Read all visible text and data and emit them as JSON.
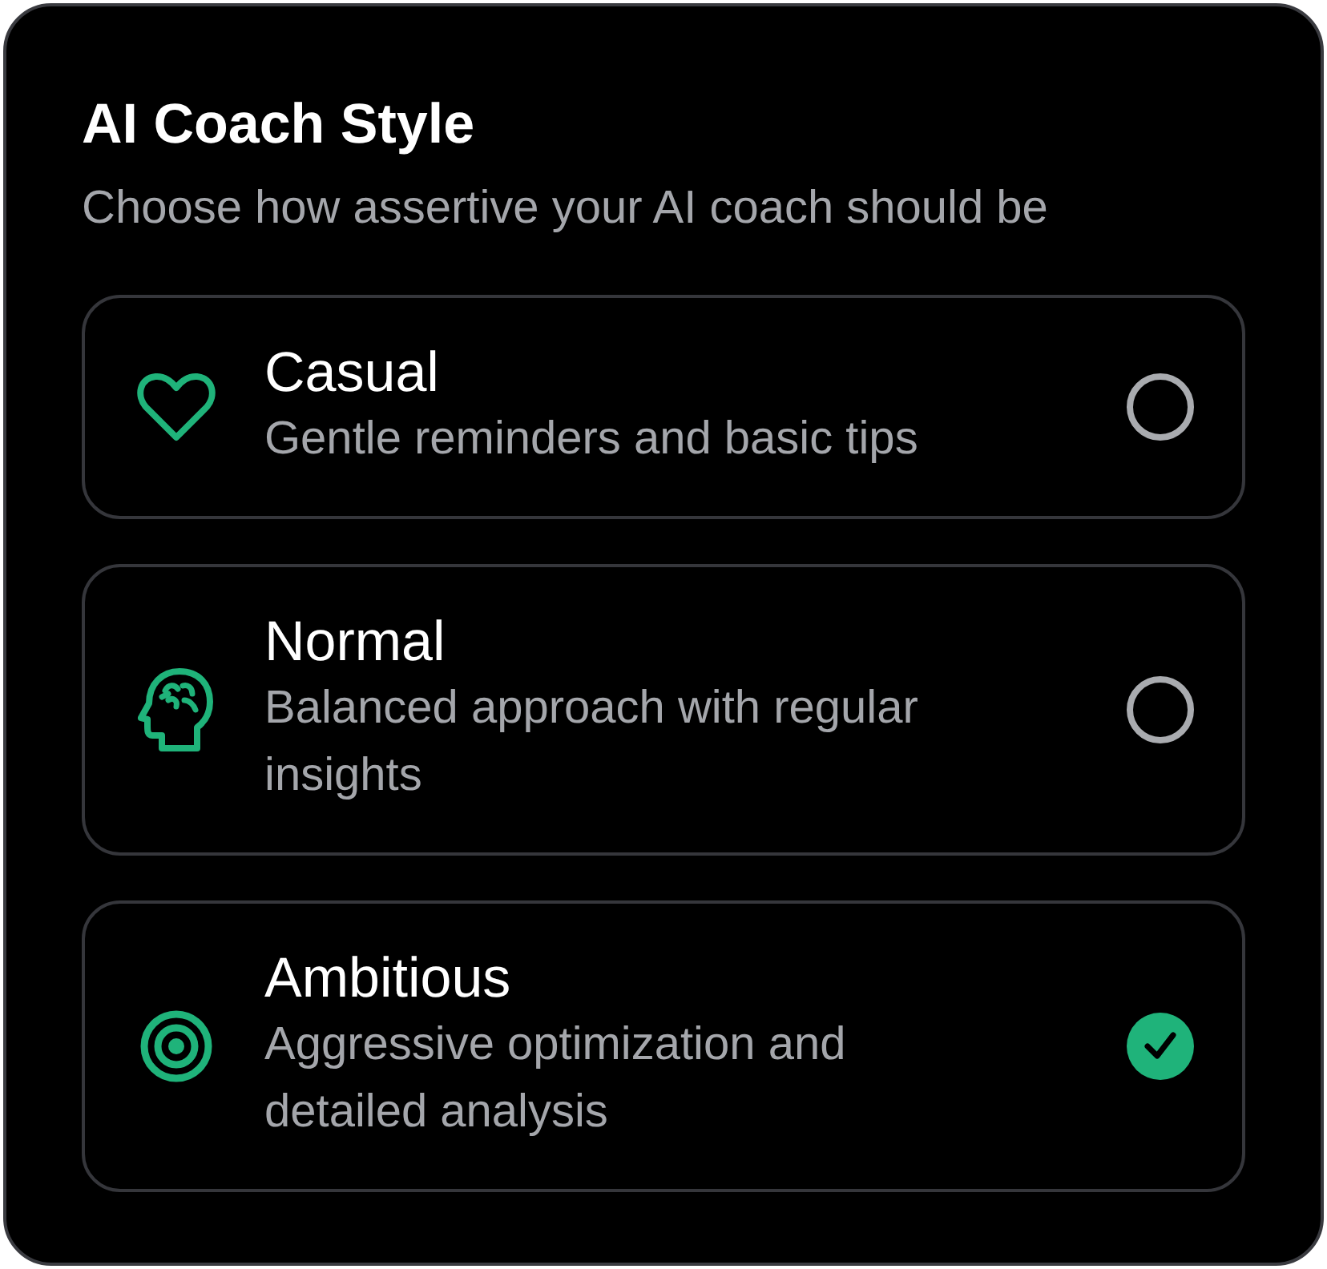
{
  "title": "AI Coach Style",
  "subtitle": "Choose how assertive your AI coach should be",
  "options": [
    {
      "kind": "heart",
      "label": "Casual",
      "description": "Gentle reminders and basic tips",
      "selected": false
    },
    {
      "kind": "head",
      "label": "Normal",
      "description": "Balanced approach with regular insights",
      "selected": false
    },
    {
      "kind": "target",
      "label": "Ambitious",
      "description": "Aggressive optimization and detailed analysis",
      "selected": true
    }
  ]
}
